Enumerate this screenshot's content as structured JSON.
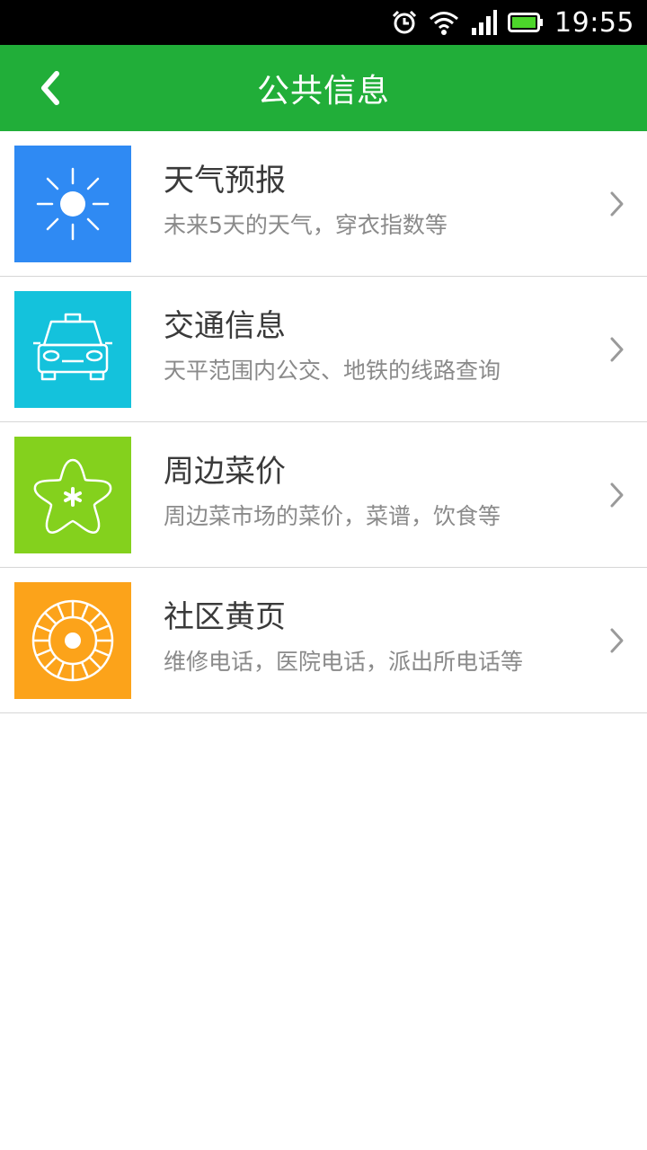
{
  "status_bar": {
    "time": "19:55",
    "icons": [
      "alarm-icon",
      "wifi-icon",
      "signal-icon",
      "battery-icon"
    ]
  },
  "header": {
    "title": "公共信息",
    "back_icon": "back-arrow-icon",
    "background": "#21ae39"
  },
  "items": [
    {
      "title": "天气预报",
      "subtitle": "未来5天的天气，穿衣指数等",
      "icon": "sun-icon",
      "color": "#2f8af3"
    },
    {
      "title": "交通信息",
      "subtitle": "天平范围内公交、地铁的线路查询",
      "icon": "taxi-icon",
      "color": "#14c2dc"
    },
    {
      "title": "周边菜价",
      "subtitle": "周边菜市场的菜价，菜谱，饮食等",
      "icon": "flower-icon",
      "color": "#84d11d"
    },
    {
      "title": "社区黄页",
      "subtitle": "维修电话，医院电话，派出所电话等",
      "icon": "dial-icon",
      "color": "#fca31a"
    }
  ]
}
